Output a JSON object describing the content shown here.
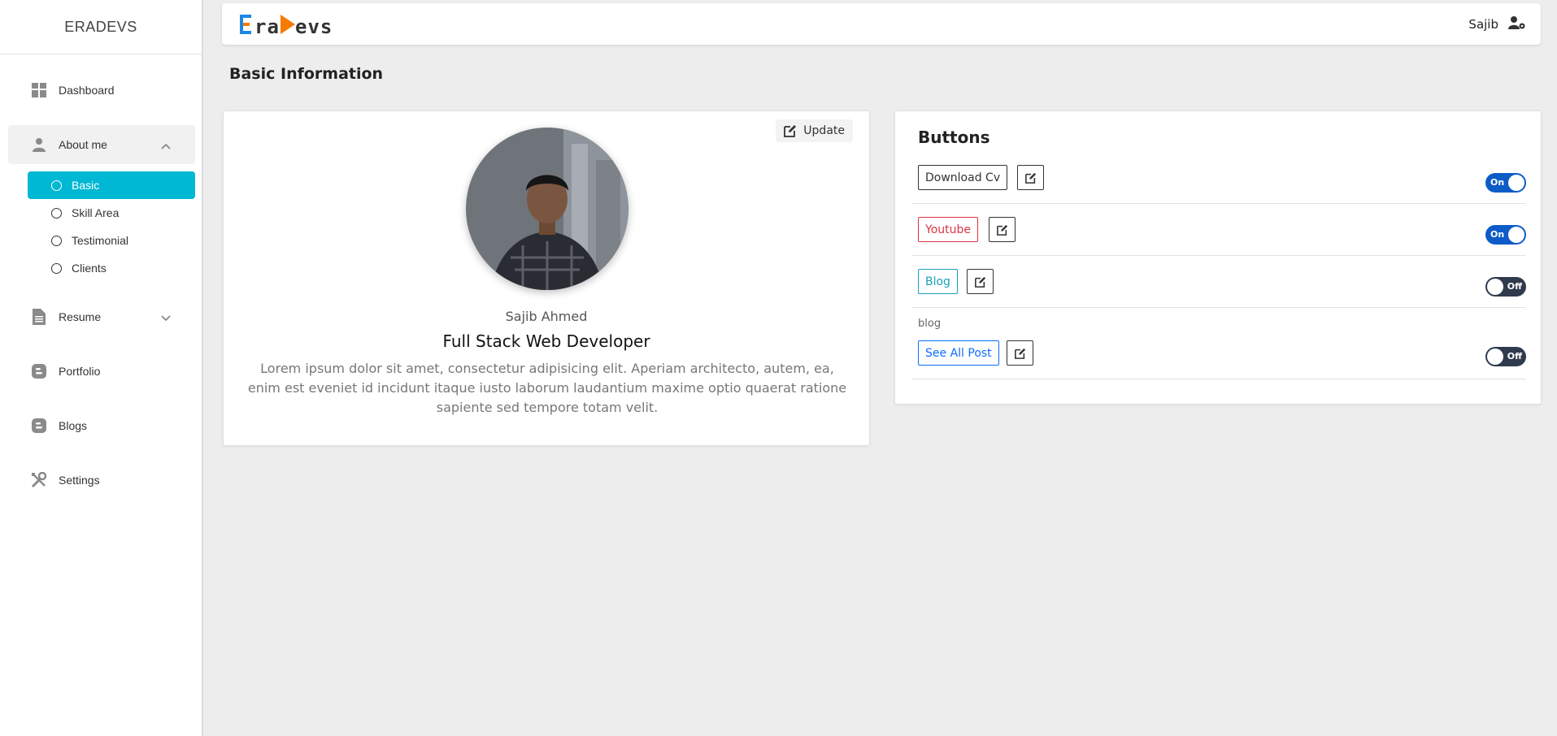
{
  "sidebar": {
    "brand": "ERADEVS",
    "items": [
      {
        "label": "Dashboard",
        "icon": "dashboard-icon"
      },
      {
        "label": "About me",
        "icon": "user-icon"
      },
      {
        "label": "Resume",
        "icon": "file-icon"
      },
      {
        "label": "Portfolio",
        "icon": "blogger-icon"
      },
      {
        "label": "Blogs",
        "icon": "blogger-icon"
      },
      {
        "label": "Settings",
        "icon": "tools-icon"
      }
    ],
    "about_sub": [
      {
        "label": "Basic"
      },
      {
        "label": "Skill Area"
      },
      {
        "label": "Testimonial"
      },
      {
        "label": "Clients"
      }
    ]
  },
  "topbar": {
    "logo_text": "EraDevs",
    "user_name": "Sajib"
  },
  "page": {
    "title": "Basic Information"
  },
  "profile": {
    "update_label": "Update",
    "name": "Sajib Ahmed",
    "role": "Full Stack Web Developer",
    "description": "Lorem ipsum dolor sit amet, consectetur adipisicing elit. Aperiam architecto, autem, ea, enim est eveniet id incidunt itaque iusto laborum laudantium maxime optio quaerat ratione sapiente sed tempore totam velit."
  },
  "buttons_panel": {
    "title": "Buttons",
    "rows": [
      {
        "label": "Download Cv",
        "color": "#333333",
        "toggle": "On",
        "state": "on",
        "sub": ""
      },
      {
        "label": "Youtube",
        "color": "#dc3545",
        "toggle": "On",
        "state": "on",
        "sub": ""
      },
      {
        "label": "Blog",
        "color": "#17a2b8",
        "toggle": "Off",
        "state": "off",
        "sub": ""
      },
      {
        "label": "See All Post",
        "color": "#0d6efd",
        "toggle": "Off",
        "state": "off",
        "sub": "blog"
      }
    ]
  },
  "colors": {
    "accent": "#00b8d4",
    "toggle_on": "#0d5bc7",
    "toggle_off": "#2f3a4d"
  }
}
